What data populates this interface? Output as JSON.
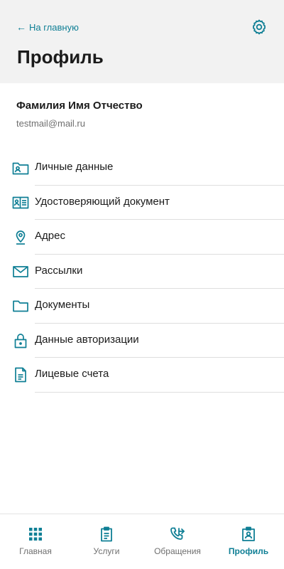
{
  "colors": {
    "accent": "#0f7f95",
    "header_bg": "#f2f2f2",
    "text": "#1b1b1b",
    "muted": "#6f6f6f",
    "divider": "#dedede"
  },
  "header": {
    "back_label": "На главную",
    "back_icon": "arrow-left-icon",
    "title": "Профиль",
    "settings_icon": "gear-icon"
  },
  "user": {
    "name": "Фамилия Имя Отчество",
    "email": "testmail@mail.ru"
  },
  "menu": {
    "items": [
      {
        "label": "Личные данные",
        "icon": "id-folder-icon"
      },
      {
        "label": "Удостоверяющий документ",
        "icon": "id-card-icon"
      },
      {
        "label": "Адрес",
        "icon": "location-pin-icon"
      },
      {
        "label": "Рассылки",
        "icon": "envelope-icon"
      },
      {
        "label": "Документы",
        "icon": "folder-icon"
      },
      {
        "label": "Данные авторизации",
        "icon": "lock-icon"
      },
      {
        "label": "Лицевые счета",
        "icon": "document-icon"
      }
    ]
  },
  "bottom_nav": {
    "items": [
      {
        "label": "Главная",
        "icon": "grid-icon",
        "active": false
      },
      {
        "label": "Услуги",
        "icon": "clipboard-icon",
        "active": false
      },
      {
        "label": "Обращения",
        "icon": "phone-forward-icon",
        "active": false
      },
      {
        "label": "Профиль",
        "icon": "profile-badge-icon",
        "active": true
      }
    ]
  }
}
